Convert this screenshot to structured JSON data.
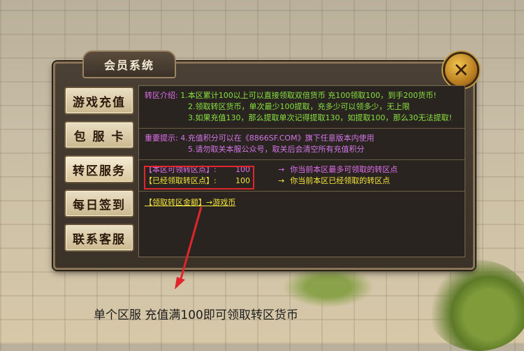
{
  "window": {
    "title": "会员系统",
    "close_label": "✕"
  },
  "menu": {
    "items": [
      {
        "label": "游戏充值",
        "name": "menu-game-recharge"
      },
      {
        "label": "包 服 卡",
        "name": "menu-server-card"
      },
      {
        "label": "转区服务",
        "name": "menu-transfer-service"
      },
      {
        "label": "每日签到",
        "name": "menu-daily-signin"
      },
      {
        "label": "联系客服",
        "name": "menu-contact-support"
      }
    ]
  },
  "intro": {
    "label": "转区介绍:",
    "line1": "1.本区累计100以上可以直接领取双倍货币 充100领取100，到手200货币!",
    "line2": "2.领取转区货币，单次最少100提取，充多少可以领多少，无上限",
    "line3": "3.如果充值130，那么提取单次记得提取130，如提取100，那么30无法提取!"
  },
  "notice": {
    "label": "重要提示:",
    "line4": "4.充值积分可以在《8866SF.COM》旗下任意版本内使用",
    "line5": "5.请勿取关本服公众号，取关后会清空所有充值积分"
  },
  "points": {
    "available_label": "【本区可领转区点】:",
    "available_value": "100",
    "available_arrow": "→",
    "available_desc": "你当前本区最多可领取的转区点",
    "claimed_label": "【已经领取转区点】:",
    "claimed_value": "100",
    "claimed_arrow": "→",
    "claimed_desc": "你当前本区已经领取的转区点"
  },
  "claim": {
    "link": "【领取转区金额】→游戏币"
  },
  "caption": "单个区服 充值满100即可领取转区货币",
  "colors": {
    "highlight_box": "#e0262c",
    "annotation_arrow": "#e0262c"
  }
}
